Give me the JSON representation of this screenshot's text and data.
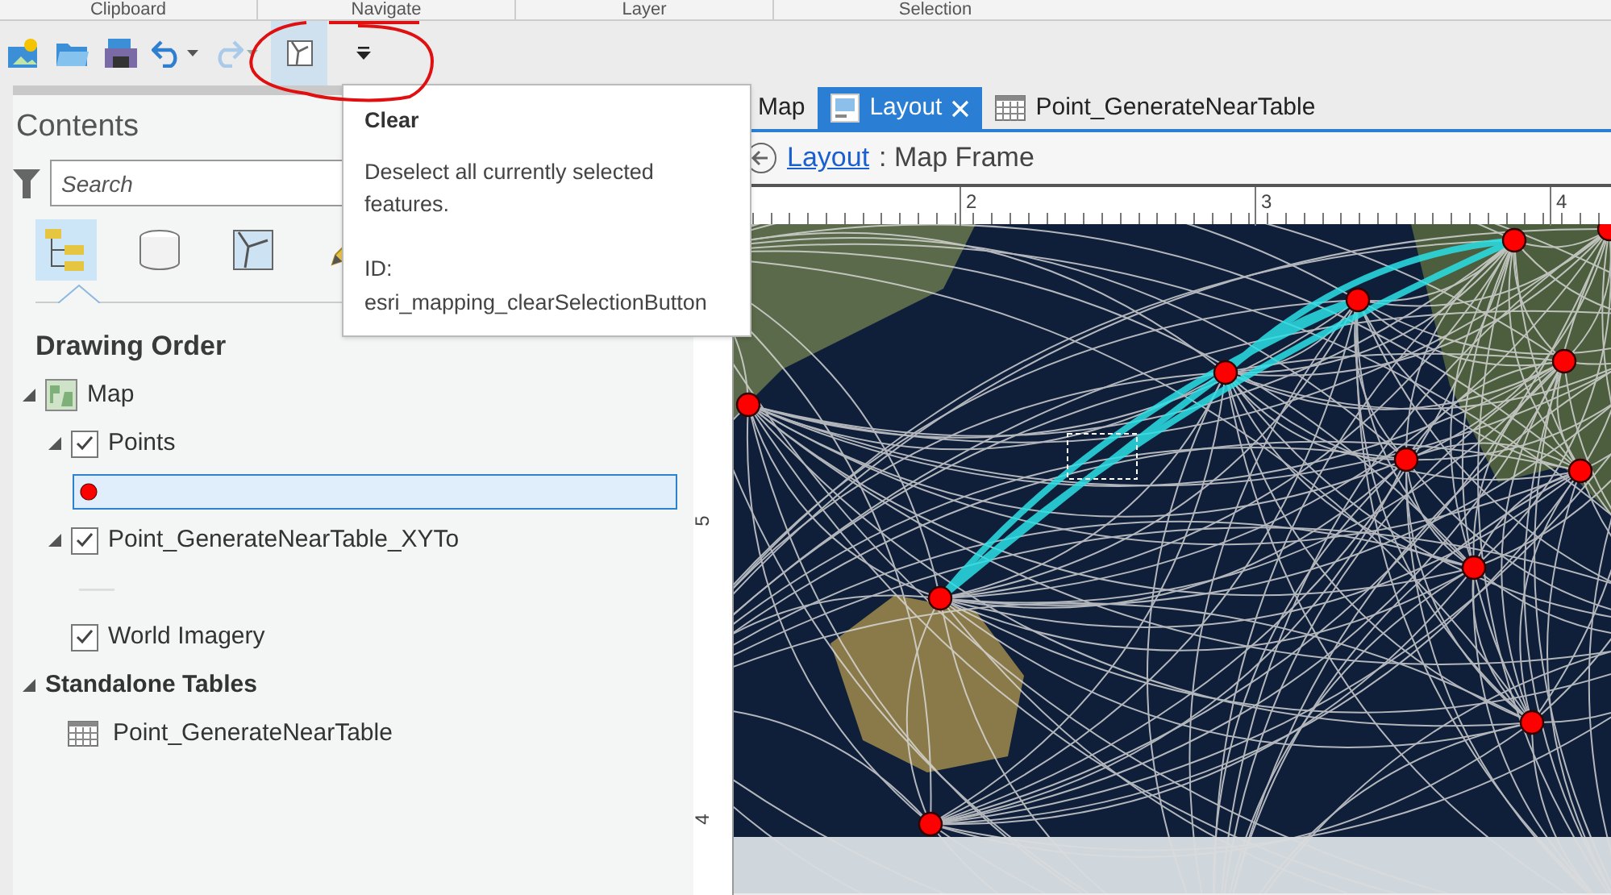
{
  "ribbon_groups": [
    "Clipboard",
    "Navigate",
    "Layer",
    "Selection"
  ],
  "toolbar": {
    "redo_disabled": true,
    "clear_hovered": true
  },
  "tooltip": {
    "title": "Clear",
    "description": "Deselect all currently selected features.",
    "id_label": "ID:",
    "id_value": "esri_mapping_clearSelectionButton"
  },
  "contents": {
    "title": "Contents",
    "search": {
      "placeholder": "Search"
    },
    "view_tabs": [
      {
        "kind": "drawing-order",
        "selected": true
      },
      {
        "kind": "source",
        "selected": false
      },
      {
        "kind": "selection",
        "selected": false
      },
      {
        "kind": "editing",
        "selected": false
      }
    ],
    "section": "Drawing Order",
    "tree": [
      {
        "kind": "map",
        "label": "Map",
        "expanded": true,
        "children": [
          {
            "kind": "layer",
            "label": "Points",
            "checked": true,
            "expanded": true,
            "children": [
              {
                "kind": "point-symbol",
                "selected": true
              }
            ]
          },
          {
            "kind": "layer",
            "label": "Point_GenerateNearTable_XYTo",
            "checked": true,
            "expanded": true,
            "children": [
              {
                "kind": "line-symbol",
                "selected": false
              }
            ]
          },
          {
            "kind": "layer",
            "label": "World Imagery",
            "checked": true
          }
        ]
      },
      {
        "kind": "group",
        "label": "Standalone Tables",
        "expanded": true,
        "children": [
          {
            "kind": "table",
            "label": "Point_GenerateNearTable"
          }
        ]
      }
    ]
  },
  "view": {
    "tabs": [
      {
        "kind": "map",
        "label": "Map",
        "selected": false
      },
      {
        "kind": "layout",
        "label": "Layout",
        "selected": true
      },
      {
        "kind": "table",
        "label": "Point_GenerateNearTable",
        "selected": false
      }
    ],
    "breadcrumb": {
      "link": "Layout",
      "rest": ": Map Frame"
    },
    "h_ruler": [
      "2",
      "3",
      "4"
    ],
    "v_ruler": [
      "5",
      "4"
    ]
  }
}
